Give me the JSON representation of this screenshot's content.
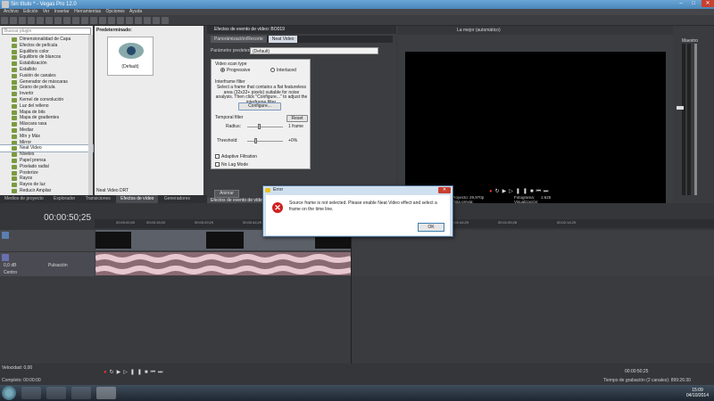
{
  "window": {
    "title": "Sin título * - Vegas Pro 12.0"
  },
  "menu": [
    "Archivo",
    "Edición",
    "Ver",
    "Insertar",
    "Herramientas",
    "Opciones",
    "Ayuda"
  ],
  "effects_tree": {
    "search_placeholder": "Buscar plugin",
    "items": [
      "Dimensionalidad de Capa",
      "Efectos de película",
      "Equilibrio color",
      "Equilibrio de blancos",
      "Estabilización",
      "Estallido",
      "Fusión de canales",
      "Generador de máscaras",
      "Grano de película",
      "Invertir",
      "Kernel de convolución",
      "Luz del relleno",
      "Mapa de bits",
      "Mapa de gradientes",
      "Máscara rasa",
      "Mediar",
      "Mín y Máx",
      "Mirror",
      "Neat Video",
      "Niveles",
      "Papel prensa",
      "Pixelado radial",
      "Posterize",
      "Rayos",
      "Rayos de luz",
      "Reducir Ampliar"
    ],
    "selected": "Neat Video"
  },
  "presets": {
    "header": "Predeterminado:",
    "thumb_caption": "(Default)",
    "footer": "Neat Video DRT"
  },
  "left_tabs": [
    "Medios de proyecto",
    "Explorador",
    "Transiciones",
    "Efectos de vídeo",
    "Generadores"
  ],
  "fx_window": {
    "title": "Efectos de evento de vídeo:",
    "title_id": "BO019",
    "chain": [
      "Panorámización/Recorte",
      "Neat Video"
    ],
    "preset_label": "Parámetro predeterminado:",
    "preset_value": "(Default)",
    "animate_label": "Animar",
    "tab_label": "Efectos de evento de vídeo"
  },
  "neat_video": {
    "scan_type_label": "Video scan type",
    "progressive": "Progressive",
    "interlaced": "Interlaced",
    "interframe_label": "Interframe filter",
    "interframe_text": "Select a frame that contains a flat featureless area (32x32+ pixels) suitable for noise analysis. Then click \"Configure...\" to adjust the interframe filter.",
    "configure": "Configure...",
    "temporal_label": "Temporal filter",
    "reset": "Reset",
    "radius_label": "Radius:",
    "radius_value": "1 frame",
    "threshold_label": "Threshold:",
    "threshold_value": "+0%",
    "adaptive": "Adaptive Filtration",
    "no_lag": "No Lag Mode"
  },
  "preview": {
    "quality": "La mejor (automático)",
    "project": "Proyecto:",
    "project_val": "29,970p",
    "preview_label": "Vista previa:",
    "frame_label": "Fotograma:",
    "frame_val": "1.625",
    "display_label": "Visualización:",
    "display_val": "x"
  },
  "master": {
    "label": "Maestro"
  },
  "timeline": {
    "timecode": "00:00:50;25",
    "ruler": [
      "00:00:00;00",
      "00:00:15;00",
      "00:00:29;29",
      "00:00:44;29",
      "00:00:59;28",
      "00:01:15;00",
      "00:01:29;29",
      "00:01:44;29",
      "00:01:59;28",
      "00:02:14;29"
    ],
    "audio_db": "0,0 dB",
    "pulsation": "Pulsación",
    "center": "Centro",
    "end_time": "00:00:50;25"
  },
  "status": {
    "rate": "Velocidad: 0,00",
    "complete": "Completo: 00:00:00",
    "record_time": "Tiempo de grabación (2 canales): 899:26:30"
  },
  "clock": {
    "time": "15:09",
    "date": "04/10/2014"
  },
  "dialog": {
    "title": "Error",
    "message": "Source frame is not selected. Please enable Neat Video effect and select a frame on the time line.",
    "ok": "OK"
  }
}
